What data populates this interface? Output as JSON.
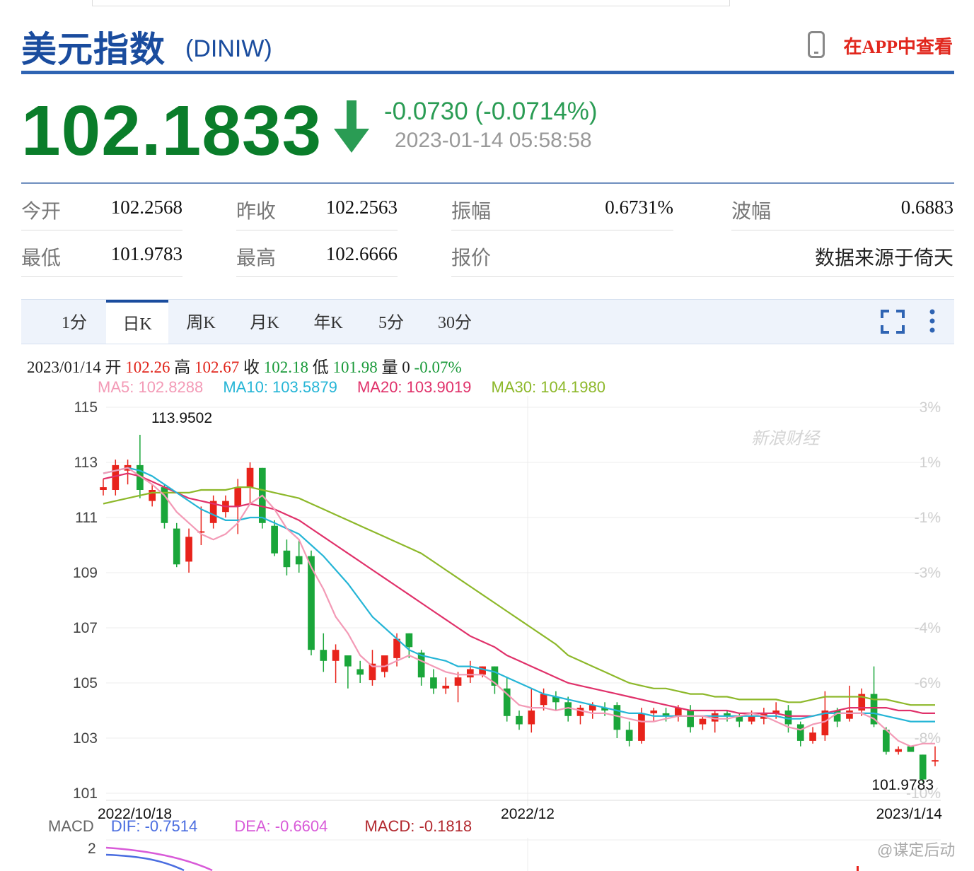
{
  "header": {
    "title": "美元指数",
    "code": "(DINIW)",
    "app_link": "在APP中查看"
  },
  "quote": {
    "price": "102.1833",
    "change": "-0.0730 (-0.0714%)",
    "timestamp": "2023-01-14 05:58:58",
    "direction": "down",
    "color_down": "#2a9c54"
  },
  "stats": {
    "open_label": "今开",
    "open": "102.2568",
    "prev_close_label": "昨收",
    "prev_close": "102.2563",
    "amplitude_label": "振幅",
    "amplitude": "0.6731%",
    "wave_label": "波幅",
    "wave": "0.6883",
    "low_label": "最低",
    "low": "101.9783",
    "high_label": "最高",
    "high": "102.6666",
    "quote_label": "报价",
    "source": "数据来源于倚天"
  },
  "tabs": [
    {
      "label": "1分"
    },
    {
      "label": "日K"
    },
    {
      "label": "周K"
    },
    {
      "label": "月K"
    },
    {
      "label": "年K"
    },
    {
      "label": "5分"
    },
    {
      "label": "30分"
    }
  ],
  "info": {
    "date": "2023/01/14",
    "open_label": "开",
    "open": "102.26",
    "high_label": "高",
    "high": "102.67",
    "close_label": "收",
    "close": "102.18",
    "low_label": "低",
    "low": "101.98",
    "vol_label": "量",
    "vol": "0",
    "pct": "-0.07%"
  },
  "ma": {
    "ma5": "MA5: 102.8288",
    "ma10": "MA10: 103.5879",
    "ma20": "MA20: 103.9019",
    "ma30": "MA30: 104.1980"
  },
  "macd": {
    "label": "MACD",
    "dif": "DIF: -0.7514",
    "dea": "DEA: -0.6604",
    "macd": "MACD: -0.1818",
    "axis_top": "2"
  },
  "watermark": "新浪财经",
  "watermark2": "@谋定后动",
  "chart_data": {
    "type": "candlestick",
    "y_ticks": [
      "115",
      "113",
      "111",
      "109",
      "107",
      "105",
      "103",
      "101"
    ],
    "pct_ticks": [
      "3%",
      "1%",
      "-1%",
      "-3%",
      "-4%",
      "-6%",
      "-8%",
      "-10%"
    ],
    "x_labels": [
      "2022/10/18",
      "2022/12",
      "2023/1/14"
    ],
    "max_label": "113.9502",
    "min_label": "101.9783",
    "ylim": [
      101,
      115
    ],
    "colors": {
      "up": "#e8231b",
      "down": "#1aa63a",
      "ma5": "#f39ab6",
      "ma10": "#25b5d6",
      "ma20": "#e0316a",
      "ma30": "#8db82a"
    },
    "candles": [
      [
        112.0,
        112.1,
        112.4,
        111.8
      ],
      [
        112.0,
        112.9,
        113.1,
        111.8
      ],
      [
        112.7,
        112.9,
        113.1,
        112.2
      ],
      [
        112.9,
        112.0,
        114.0,
        111.7
      ],
      [
        111.6,
        112.0,
        112.2,
        111.4
      ],
      [
        112.1,
        110.8,
        112.2,
        110.6
      ],
      [
        110.6,
        109.3,
        110.8,
        109.2
      ],
      [
        109.4,
        110.3,
        110.6,
        109.0
      ],
      [
        110.5,
        110.5,
        111.4,
        110.0
      ],
      [
        110.8,
        111.6,
        111.8,
        110.6
      ],
      [
        111.2,
        111.6,
        111.8,
        111.0
      ],
      [
        111.4,
        112.1,
        112.4,
        110.4
      ],
      [
        112.1,
        112.8,
        113.0,
        111.5
      ],
      [
        112.8,
        110.8,
        112.8,
        110.6
      ],
      [
        110.7,
        109.7,
        110.9,
        109.6
      ],
      [
        109.8,
        109.2,
        110.2,
        108.9
      ],
      [
        109.6,
        109.3,
        110.2,
        109.0
      ],
      [
        109.6,
        106.2,
        109.8,
        106.0
      ],
      [
        106.2,
        105.8,
        106.8,
        105.4
      ],
      [
        105.8,
        106.2,
        106.4,
        105.0
      ],
      [
        106.0,
        105.6,
        106.0,
        104.8
      ],
      [
        105.5,
        105.3,
        105.8,
        105.0
      ],
      [
        105.1,
        105.7,
        106.2,
        104.9
      ],
      [
        105.4,
        106.0,
        106.0,
        105.2
      ],
      [
        105.9,
        106.6,
        106.8,
        105.6
      ],
      [
        106.8,
        106.3,
        106.8,
        105.9
      ],
      [
        106.1,
        105.2,
        106.2,
        104.9
      ],
      [
        105.2,
        104.8,
        105.5,
        104.6
      ],
      [
        104.8,
        104.9,
        105.2,
        104.6
      ],
      [
        104.9,
        105.2,
        105.4,
        104.3
      ],
      [
        105.2,
        105.5,
        105.8,
        105.0
      ],
      [
        105.3,
        105.6,
        105.6,
        105.2
      ],
      [
        105.6,
        104.9,
        105.6,
        104.6
      ],
      [
        104.8,
        103.8,
        105.2,
        103.6
      ],
      [
        103.8,
        103.5,
        104.0,
        103.3
      ],
      [
        103.5,
        104.0,
        104.8,
        103.2
      ],
      [
        104.2,
        104.6,
        104.8,
        104.0
      ],
      [
        104.5,
        104.3,
        104.7,
        104.0
      ],
      [
        104.3,
        103.8,
        104.5,
        103.6
      ],
      [
        103.8,
        104.1,
        104.2,
        103.5
      ],
      [
        104.0,
        104.2,
        104.3,
        103.7
      ],
      [
        104.1,
        104.0,
        104.3,
        103.8
      ],
      [
        104.2,
        103.3,
        104.3,
        103.0
      ],
      [
        103.3,
        102.9,
        103.6,
        102.7
      ],
      [
        102.9,
        103.9,
        104.1,
        102.8
      ],
      [
        103.9,
        104.0,
        104.1,
        103.6
      ],
      [
        103.9,
        103.8,
        104.1,
        103.6
      ],
      [
        103.8,
        104.1,
        104.2,
        103.6
      ],
      [
        104.0,
        103.4,
        104.2,
        103.2
      ],
      [
        103.5,
        103.7,
        103.8,
        103.3
      ],
      [
        103.6,
        103.9,
        104.0,
        103.2
      ],
      [
        103.9,
        103.8,
        104.0,
        103.6
      ],
      [
        103.8,
        103.6,
        103.9,
        103.4
      ],
      [
        103.6,
        103.8,
        104.0,
        103.5
      ],
      [
        103.7,
        103.9,
        104.1,
        103.5
      ],
      [
        103.9,
        104.0,
        104.3,
        103.7
      ],
      [
        104.0,
        103.5,
        104.2,
        103.2
      ],
      [
        103.5,
        102.9,
        103.6,
        102.7
      ],
      [
        102.9,
        103.2,
        103.4,
        102.8
      ],
      [
        103.1,
        104.0,
        104.7,
        102.9
      ],
      [
        104.0,
        103.6,
        104.1,
        103.4
      ],
      [
        103.7,
        104.0,
        104.9,
        103.6
      ],
      [
        104.0,
        104.6,
        104.8,
        103.8
      ],
      [
        104.6,
        103.5,
        105.6,
        103.4
      ],
      [
        103.3,
        102.5,
        103.4,
        102.4
      ],
      [
        102.5,
        102.6,
        102.7,
        102.4
      ],
      [
        102.7,
        102.5,
        102.7,
        102.5
      ],
      [
        102.4,
        101.5,
        102.4,
        101.4
      ],
      [
        102.2,
        102.2,
        102.7,
        101.98
      ]
    ],
    "ma5": [
      112.6,
      112.7,
      112.8,
      112.5,
      112.2,
      111.8,
      111.2,
      110.8,
      110.4,
      110.2,
      110.4,
      110.8,
      111.5,
      111.8,
      111.3,
      110.6,
      110.2,
      109.2,
      108.4,
      107.4,
      106.8,
      106.0,
      105.6,
      105.6,
      105.8,
      106.0,
      105.8,
      105.6,
      105.4,
      105.3,
      105.3,
      105.3,
      105.0,
      104.6,
      104.2,
      104.1,
      104.1,
      104.0,
      104.1,
      104.0,
      103.9,
      103.9,
      103.8,
      103.7,
      103.6,
      103.6,
      103.7,
      103.8,
      103.8,
      103.8,
      103.7,
      103.7,
      103.8,
      103.9,
      103.8,
      103.6,
      103.4,
      103.3,
      103.5,
      103.6,
      103.9,
      103.9,
      103.9,
      103.7,
      103.3,
      102.9,
      102.7,
      102.8,
      102.8
    ],
    "ma10": [
      112.6,
      112.7,
      112.8,
      112.7,
      112.5,
      112.2,
      111.9,
      111.6,
      111.3,
      111.1,
      110.9,
      110.9,
      111.0,
      111.0,
      110.8,
      110.6,
      110.4,
      110.0,
      109.6,
      109.1,
      108.6,
      108.0,
      107.4,
      107.0,
      106.6,
      106.2,
      106.0,
      105.9,
      105.8,
      105.6,
      105.6,
      105.5,
      105.4,
      105.2,
      105.0,
      104.8,
      104.6,
      104.5,
      104.4,
      104.3,
      104.2,
      104.1,
      104.0,
      103.9,
      103.9,
      103.8,
      103.8,
      103.8,
      103.8,
      103.8,
      103.8,
      103.8,
      103.8,
      103.8,
      103.8,
      103.8,
      103.7,
      103.7,
      103.8,
      103.9,
      103.9,
      103.9,
      103.9,
      103.9,
      103.8,
      103.7,
      103.6,
      103.6,
      103.6
    ],
    "ma20": [
      112.4,
      112.5,
      112.6,
      112.5,
      112.3,
      112.1,
      111.9,
      111.7,
      111.6,
      111.5,
      111.4,
      111.4,
      111.5,
      111.4,
      111.3,
      111.1,
      110.9,
      110.6,
      110.3,
      110.0,
      109.7,
      109.4,
      109.1,
      108.8,
      108.5,
      108.2,
      107.9,
      107.6,
      107.3,
      107.0,
      106.7,
      106.5,
      106.3,
      106.0,
      105.8,
      105.6,
      105.4,
      105.2,
      105.0,
      104.9,
      104.8,
      104.7,
      104.6,
      104.5,
      104.4,
      104.3,
      104.2,
      104.1,
      104.0,
      104.0,
      104.0,
      104.0,
      103.9,
      103.9,
      103.9,
      103.9,
      103.8,
      103.8,
      103.8,
      103.9,
      104.0,
      104.1,
      104.1,
      104.1,
      104.1,
      104.0,
      104.0,
      103.9,
      103.9
    ],
    "ma30": [
      111.5,
      111.6,
      111.7,
      111.8,
      111.9,
      111.9,
      111.9,
      111.9,
      112.0,
      112.0,
      112.0,
      112.1,
      112.1,
      112.0,
      111.9,
      111.8,
      111.7,
      111.5,
      111.3,
      111.1,
      110.9,
      110.7,
      110.5,
      110.3,
      110.1,
      109.9,
      109.7,
      109.4,
      109.1,
      108.8,
      108.5,
      108.2,
      107.9,
      107.6,
      107.3,
      107.0,
      106.7,
      106.4,
      106.0,
      105.8,
      105.6,
      105.4,
      105.2,
      105.0,
      104.9,
      104.8,
      104.8,
      104.7,
      104.6,
      104.6,
      104.5,
      104.5,
      104.4,
      104.4,
      104.4,
      104.4,
      104.3,
      104.3,
      104.4,
      104.5,
      104.5,
      104.5,
      104.5,
      104.4,
      104.4,
      104.3,
      104.2,
      104.2,
      104.2
    ]
  }
}
